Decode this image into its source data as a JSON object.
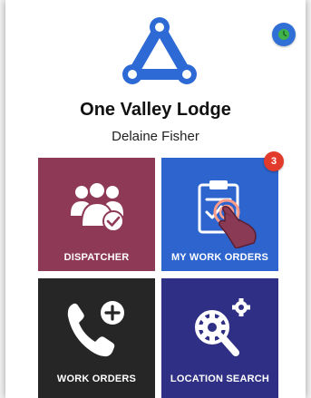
{
  "header": {
    "org_name": "One Valley Lodge",
    "user_name": "Delaine Fisher"
  },
  "status": {
    "icon": "clock-icon",
    "color": "#2f6fd6"
  },
  "logo": {
    "icon": "triangle-circles-logo",
    "color": "#2d6ad6"
  },
  "tiles": [
    {
      "label": "DISPATCHER",
      "icon": "team-check-icon",
      "color": "#8e3a57"
    },
    {
      "label": "MY WORK ORDERS",
      "icon": "clipboard-touch-icon",
      "color": "#2d64cd",
      "badge": "3"
    },
    {
      "label": "WORK ORDERS",
      "icon": "phone-add-icon",
      "color": "#262626"
    },
    {
      "label": "LOCATION SEARCH",
      "icon": "gear-search-icon",
      "color": "#2e2f85"
    }
  ]
}
